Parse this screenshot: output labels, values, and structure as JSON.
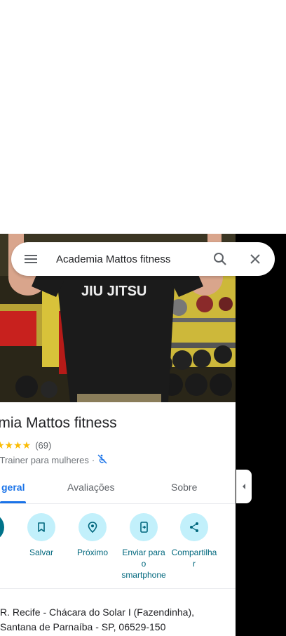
{
  "search": {
    "query": "Academia Mattos fitness"
  },
  "place": {
    "title": "demia Mattos fitness",
    "stars": "★★★★",
    "review_count": "(69)",
    "category": "al Trainer para mulheres",
    "separator": "·"
  },
  "tabs": [
    {
      "label": " geral",
      "active": true
    },
    {
      "label": "Avaliações",
      "active": false
    },
    {
      "label": "Sobre",
      "active": false
    }
  ],
  "actions": [
    {
      "label": "s",
      "icon": "directions-icon"
    },
    {
      "label": "Salvar",
      "icon": "bookmark-icon"
    },
    {
      "label": "Próximo",
      "icon": "nearby-icon"
    },
    {
      "label": "Enviar para o smartphone",
      "line1": "Enviar para",
      "line2": "o",
      "line3": "smartphone",
      "icon": "send-to-phone-icon"
    },
    {
      "label": "Compartilhar",
      "line1": "Compartilha",
      "line2": "r",
      "icon": "share-icon"
    }
  ],
  "address": {
    "line1": "R. Recife - Chácara do Solar I (Fazendinha),",
    "line2": "Santana de Parnaíba - SP, 06529-150"
  },
  "hero": {
    "shirt_text": "JIU JITSU"
  },
  "colors": {
    "accent": "#1a73e8",
    "action_bg": "#c2f0fb",
    "action_text": "#00677d",
    "star": "#fbbc04"
  }
}
